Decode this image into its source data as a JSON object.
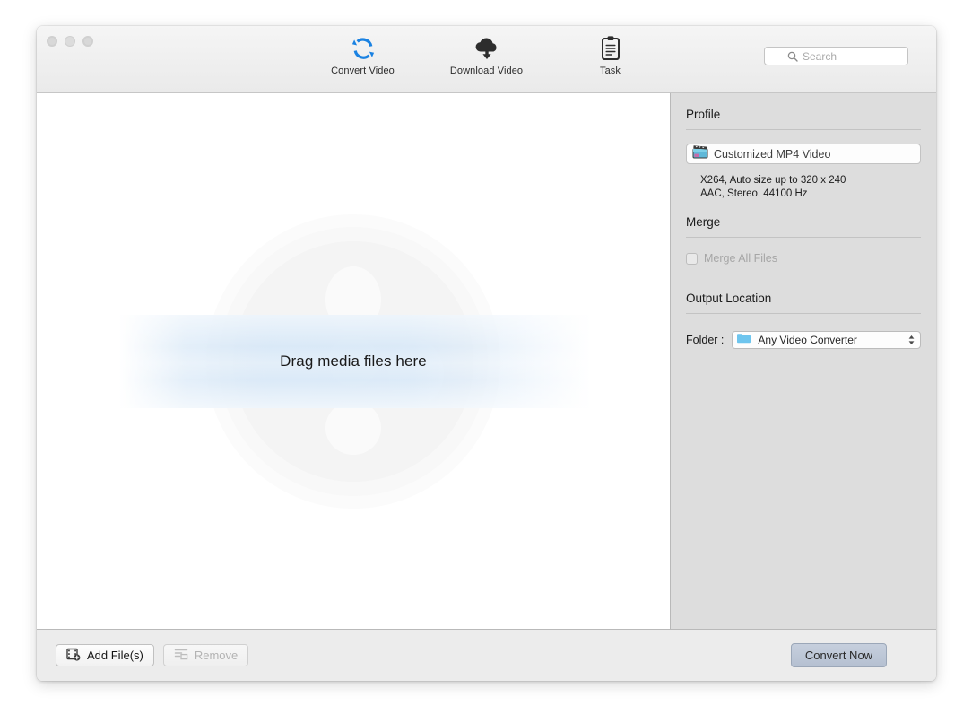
{
  "window": {
    "traffic_lights": [
      "close",
      "minimize",
      "zoom"
    ]
  },
  "toolbar": {
    "items": [
      {
        "id": "convert-video",
        "label": "Convert Video",
        "icon": "refresh-circular-icon"
      },
      {
        "id": "download-video",
        "label": "Download Video",
        "icon": "cloud-download-icon"
      },
      {
        "id": "task",
        "label": "Task",
        "icon": "clipboard-icon"
      }
    ],
    "search": {
      "placeholder": "Search",
      "value": "",
      "icon": "search-icon"
    }
  },
  "drop_area": {
    "message": "Drag media files here",
    "watermark": "film-reel-icon"
  },
  "sidebar": {
    "profile": {
      "title": "Profile",
      "selected": "Customized MP4 Video",
      "icon": "clapperboard-icon",
      "video_detail": "X264, Auto size up to 320 x 240",
      "audio_detail": "AAC, Stereo, 44100 Hz"
    },
    "merge": {
      "title": "Merge",
      "checkbox_label": "Merge All Files",
      "checked": false,
      "enabled": false
    },
    "output": {
      "title": "Output Location",
      "folder_label": "Folder :",
      "folder_value": "Any Video Converter",
      "folder_icon": "folder-icon",
      "chevron_icon": "chevron-updown-icon"
    }
  },
  "bottom_bar": {
    "add_files_label": "Add File(s)",
    "add_files_icon": "film-add-icon",
    "remove_label": "Remove",
    "remove_icon": "list-remove-icon",
    "remove_enabled": false,
    "convert_label": "Convert Now"
  },
  "colors": {
    "accent_blue": "#1a82e2",
    "folder_blue": "#6ec5ee",
    "band_blue": "#d6e7f7",
    "sidebar_bg": "#dddddd",
    "toolbar_bg": "#f1f1f1",
    "convert_button": "#bcc6d6"
  }
}
